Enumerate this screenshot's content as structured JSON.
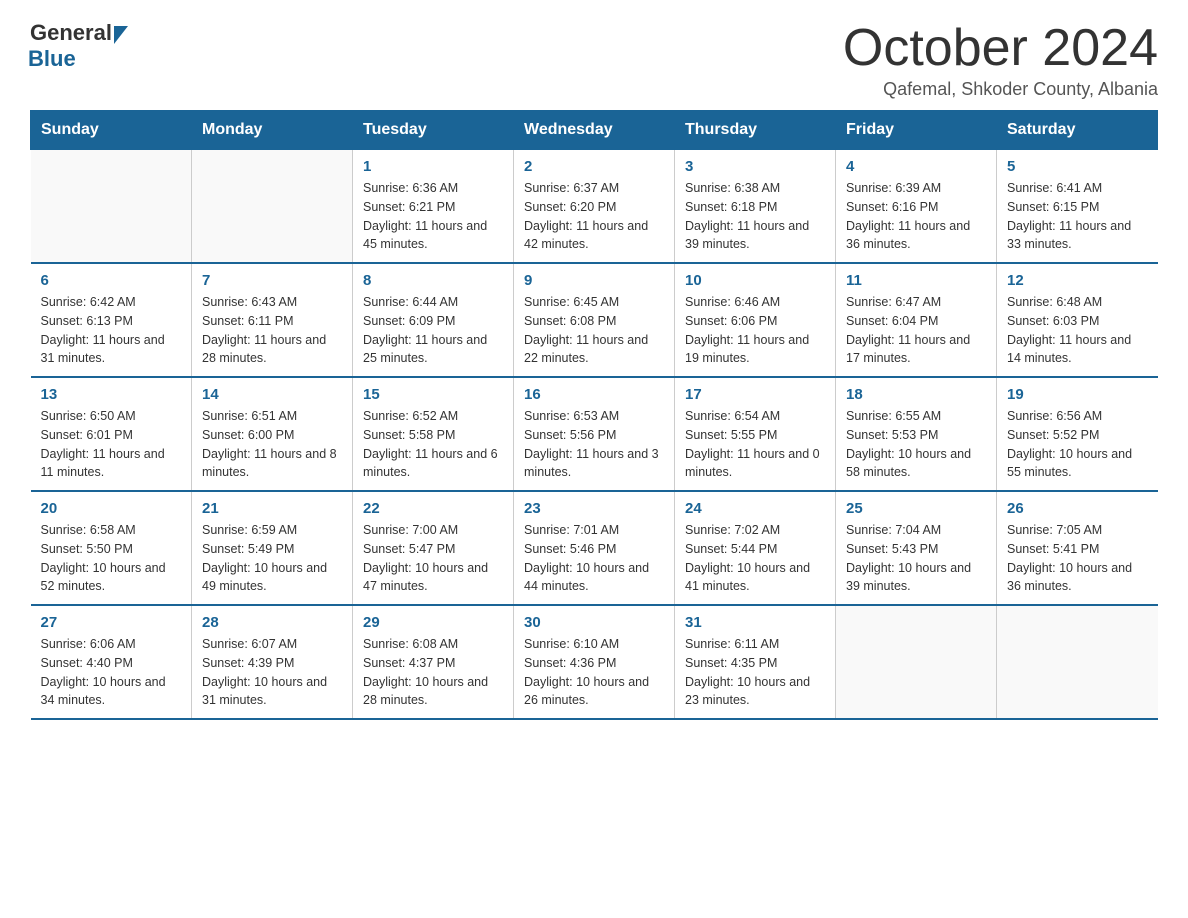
{
  "header": {
    "logo_general": "General",
    "logo_blue": "Blue",
    "title": "October 2024",
    "location": "Qafemal, Shkoder County, Albania"
  },
  "calendar": {
    "days_of_week": [
      "Sunday",
      "Monday",
      "Tuesday",
      "Wednesday",
      "Thursday",
      "Friday",
      "Saturday"
    ],
    "weeks": [
      [
        {
          "day": "",
          "sunrise": "",
          "sunset": "",
          "daylight": ""
        },
        {
          "day": "",
          "sunrise": "",
          "sunset": "",
          "daylight": ""
        },
        {
          "day": "1",
          "sunrise": "Sunrise: 6:36 AM",
          "sunset": "Sunset: 6:21 PM",
          "daylight": "Daylight: 11 hours and 45 minutes."
        },
        {
          "day": "2",
          "sunrise": "Sunrise: 6:37 AM",
          "sunset": "Sunset: 6:20 PM",
          "daylight": "Daylight: 11 hours and 42 minutes."
        },
        {
          "day": "3",
          "sunrise": "Sunrise: 6:38 AM",
          "sunset": "Sunset: 6:18 PM",
          "daylight": "Daylight: 11 hours and 39 minutes."
        },
        {
          "day": "4",
          "sunrise": "Sunrise: 6:39 AM",
          "sunset": "Sunset: 6:16 PM",
          "daylight": "Daylight: 11 hours and 36 minutes."
        },
        {
          "day": "5",
          "sunrise": "Sunrise: 6:41 AM",
          "sunset": "Sunset: 6:15 PM",
          "daylight": "Daylight: 11 hours and 33 minutes."
        }
      ],
      [
        {
          "day": "6",
          "sunrise": "Sunrise: 6:42 AM",
          "sunset": "Sunset: 6:13 PM",
          "daylight": "Daylight: 11 hours and 31 minutes."
        },
        {
          "day": "7",
          "sunrise": "Sunrise: 6:43 AM",
          "sunset": "Sunset: 6:11 PM",
          "daylight": "Daylight: 11 hours and 28 minutes."
        },
        {
          "day": "8",
          "sunrise": "Sunrise: 6:44 AM",
          "sunset": "Sunset: 6:09 PM",
          "daylight": "Daylight: 11 hours and 25 minutes."
        },
        {
          "day": "9",
          "sunrise": "Sunrise: 6:45 AM",
          "sunset": "Sunset: 6:08 PM",
          "daylight": "Daylight: 11 hours and 22 minutes."
        },
        {
          "day": "10",
          "sunrise": "Sunrise: 6:46 AM",
          "sunset": "Sunset: 6:06 PM",
          "daylight": "Daylight: 11 hours and 19 minutes."
        },
        {
          "day": "11",
          "sunrise": "Sunrise: 6:47 AM",
          "sunset": "Sunset: 6:04 PM",
          "daylight": "Daylight: 11 hours and 17 minutes."
        },
        {
          "day": "12",
          "sunrise": "Sunrise: 6:48 AM",
          "sunset": "Sunset: 6:03 PM",
          "daylight": "Daylight: 11 hours and 14 minutes."
        }
      ],
      [
        {
          "day": "13",
          "sunrise": "Sunrise: 6:50 AM",
          "sunset": "Sunset: 6:01 PM",
          "daylight": "Daylight: 11 hours and 11 minutes."
        },
        {
          "day": "14",
          "sunrise": "Sunrise: 6:51 AM",
          "sunset": "Sunset: 6:00 PM",
          "daylight": "Daylight: 11 hours and 8 minutes."
        },
        {
          "day": "15",
          "sunrise": "Sunrise: 6:52 AM",
          "sunset": "Sunset: 5:58 PM",
          "daylight": "Daylight: 11 hours and 6 minutes."
        },
        {
          "day": "16",
          "sunrise": "Sunrise: 6:53 AM",
          "sunset": "Sunset: 5:56 PM",
          "daylight": "Daylight: 11 hours and 3 minutes."
        },
        {
          "day": "17",
          "sunrise": "Sunrise: 6:54 AM",
          "sunset": "Sunset: 5:55 PM",
          "daylight": "Daylight: 11 hours and 0 minutes."
        },
        {
          "day": "18",
          "sunrise": "Sunrise: 6:55 AM",
          "sunset": "Sunset: 5:53 PM",
          "daylight": "Daylight: 10 hours and 58 minutes."
        },
        {
          "day": "19",
          "sunrise": "Sunrise: 6:56 AM",
          "sunset": "Sunset: 5:52 PM",
          "daylight": "Daylight: 10 hours and 55 minutes."
        }
      ],
      [
        {
          "day": "20",
          "sunrise": "Sunrise: 6:58 AM",
          "sunset": "Sunset: 5:50 PM",
          "daylight": "Daylight: 10 hours and 52 minutes."
        },
        {
          "day": "21",
          "sunrise": "Sunrise: 6:59 AM",
          "sunset": "Sunset: 5:49 PM",
          "daylight": "Daylight: 10 hours and 49 minutes."
        },
        {
          "day": "22",
          "sunrise": "Sunrise: 7:00 AM",
          "sunset": "Sunset: 5:47 PM",
          "daylight": "Daylight: 10 hours and 47 minutes."
        },
        {
          "day": "23",
          "sunrise": "Sunrise: 7:01 AM",
          "sunset": "Sunset: 5:46 PM",
          "daylight": "Daylight: 10 hours and 44 minutes."
        },
        {
          "day": "24",
          "sunrise": "Sunrise: 7:02 AM",
          "sunset": "Sunset: 5:44 PM",
          "daylight": "Daylight: 10 hours and 41 minutes."
        },
        {
          "day": "25",
          "sunrise": "Sunrise: 7:04 AM",
          "sunset": "Sunset: 5:43 PM",
          "daylight": "Daylight: 10 hours and 39 minutes."
        },
        {
          "day": "26",
          "sunrise": "Sunrise: 7:05 AM",
          "sunset": "Sunset: 5:41 PM",
          "daylight": "Daylight: 10 hours and 36 minutes."
        }
      ],
      [
        {
          "day": "27",
          "sunrise": "Sunrise: 6:06 AM",
          "sunset": "Sunset: 4:40 PM",
          "daylight": "Daylight: 10 hours and 34 minutes."
        },
        {
          "day": "28",
          "sunrise": "Sunrise: 6:07 AM",
          "sunset": "Sunset: 4:39 PM",
          "daylight": "Daylight: 10 hours and 31 minutes."
        },
        {
          "day": "29",
          "sunrise": "Sunrise: 6:08 AM",
          "sunset": "Sunset: 4:37 PM",
          "daylight": "Daylight: 10 hours and 28 minutes."
        },
        {
          "day": "30",
          "sunrise": "Sunrise: 6:10 AM",
          "sunset": "Sunset: 4:36 PM",
          "daylight": "Daylight: 10 hours and 26 minutes."
        },
        {
          "day": "31",
          "sunrise": "Sunrise: 6:11 AM",
          "sunset": "Sunset: 4:35 PM",
          "daylight": "Daylight: 10 hours and 23 minutes."
        },
        {
          "day": "",
          "sunrise": "",
          "sunset": "",
          "daylight": ""
        },
        {
          "day": "",
          "sunrise": "",
          "sunset": "",
          "daylight": ""
        }
      ]
    ]
  }
}
